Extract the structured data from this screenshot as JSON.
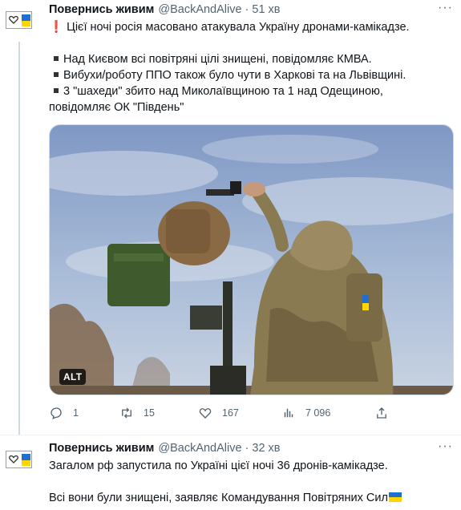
{
  "tweets": [
    {
      "author_name": "Повернись живим",
      "handle": "@BackAndAlive",
      "separator": "·",
      "time": "51 хв",
      "more_label": "···",
      "lines": [
        "Цієї ночі росія масовано атакувала Україну дронами-камікадзе.",
        "Над Києвом всі повітряні цілі знищені, повідомляє КМВА.",
        "Вибухи/роботу ППО також було чути в Харкові та на Львівщині.",
        "3 \"шахеди\" збито над Миколаївщиною та 1 над Одещиною,",
        "повідомляє ОК \"Південь\""
      ],
      "lead_symbol": "❗",
      "media_alt_badge": "ALT",
      "actions": {
        "reply_count": "1",
        "retweet_count": "15",
        "like_count": "167",
        "views_count": "7 096"
      },
      "icons": {
        "reply": "reply-icon",
        "retweet": "retweet-icon",
        "like": "heart-icon",
        "views": "views-icon",
        "share": "share-icon"
      }
    },
    {
      "author_name": "Повернись живим",
      "handle": "@BackAndAlive",
      "separator": "·",
      "time": "32 хв",
      "more_label": "···",
      "lines": [
        "Загалом рф запустила по Україні цієї ночі 36 дронів-камікадзе.",
        "Всі вони були знищені, заявляє Командування Повітряних Сил"
      ],
      "flag_emoji": "🇺🇦"
    }
  ],
  "colors": {
    "text": "#0f1419",
    "secondary": "#536471",
    "flag_blue": "#1f6fd1",
    "flag_yellow": "#ffd500"
  }
}
